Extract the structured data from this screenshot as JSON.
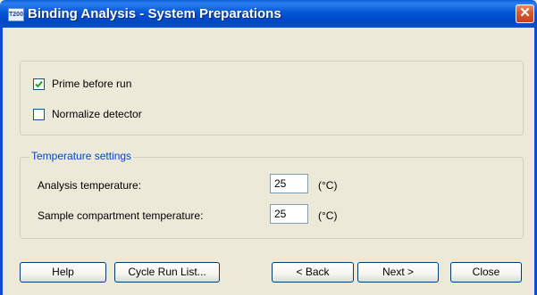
{
  "window": {
    "icon_text": "T200",
    "title": "Binding Analysis - System Preparations",
    "close_glyph": "✕"
  },
  "options": {
    "prime_before_run": {
      "label": "Prime before run",
      "checked": true
    },
    "normalize_detector": {
      "label": "Normalize detector",
      "checked": false
    }
  },
  "temperature": {
    "legend": "Temperature settings",
    "analysis": {
      "label": "Analysis temperature:",
      "value": "25",
      "unit": "(°C)"
    },
    "sample_compartment": {
      "label": "Sample compartment temperature:",
      "value": "25",
      "unit": "(°C)"
    }
  },
  "buttons": {
    "help": "Help",
    "cycle_run_list": "Cycle Run List...",
    "back": "< Back",
    "next": "Next >",
    "close": "Close"
  }
}
